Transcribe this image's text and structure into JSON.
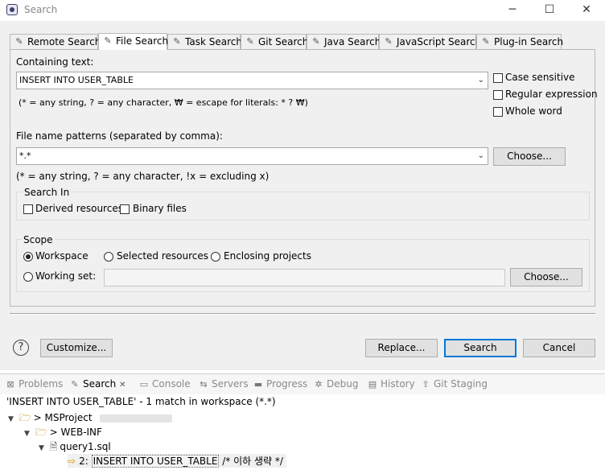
{
  "window": {
    "title": "Search",
    "minimize": "─",
    "maximize": "☐",
    "close": "✕"
  },
  "tabs": [
    {
      "label": "Remote Search",
      "icon": "✎"
    },
    {
      "label": "File Search",
      "icon": "✎"
    },
    {
      "label": "Task Search",
      "icon": "✎"
    },
    {
      "label": "Git Search",
      "icon": "✎"
    },
    {
      "label": "Java Search",
      "icon": "✎"
    },
    {
      "label": "JavaScript Search",
      "icon": "✎"
    },
    {
      "label": "Plug-in Search",
      "icon": "✎"
    }
  ],
  "file_search": {
    "containing_label": "Containing text:",
    "containing_value": "INSERT INTO USER_TABLE",
    "containing_hint": "(* = any string, ? = any character, ₩ = escape for literals: * ? ₩)",
    "case_sensitive": "Case sensitive",
    "regex": "Regular expression",
    "whole_word": "Whole word",
    "patterns_label": "File name patterns (separated by comma):",
    "patterns_value": "*.*",
    "patterns_hint": "(* = any string, ? = any character, !x = excluding x)",
    "choose_label": "Choose...",
    "search_in_title": "Search In",
    "derived": "Derived resources",
    "binary": "Binary files",
    "scope_title": "Scope",
    "workspace": "Workspace",
    "selected_resources": "Selected resources",
    "enclosing_projects": "Enclosing projects",
    "working_set": "Working set:",
    "working_set_value": "",
    "choose2_label": "Choose..."
  },
  "footer": {
    "help": "?",
    "customize": "Customize...",
    "replace": "Replace...",
    "search": "Search",
    "cancel": "Cancel"
  },
  "views": [
    {
      "label": "Problems",
      "icon": "⊠"
    },
    {
      "label": "Search",
      "icon": "✎",
      "close": "✕"
    },
    {
      "label": "Console",
      "icon": "▭"
    },
    {
      "label": "Servers",
      "icon": "⇆"
    },
    {
      "label": "Progress",
      "icon": "▬"
    },
    {
      "label": "Debug",
      "icon": "✲"
    },
    {
      "label": "History",
      "icon": "▤"
    },
    {
      "label": "Git Staging",
      "icon": "⇪"
    }
  ],
  "results": {
    "summary": "'INSERT INTO USER_TABLE' - 1 match in workspace (*.*)",
    "project": "> MSProject",
    "folder": "> WEB-INF",
    "file": "query1.sql",
    "line_no": "2: ",
    "match_text": "INSERT INTO USER_TABLE",
    "rest_text": " /* 이하 생략 */"
  }
}
